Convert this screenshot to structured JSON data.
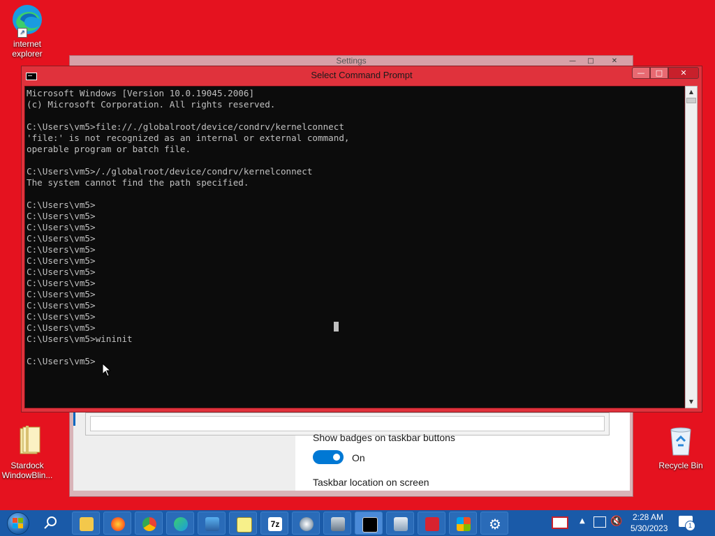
{
  "desktop": {
    "icons": [
      {
        "label": "internet\nexplorer",
        "label_line1": "internet",
        "label_line2": "explorer"
      },
      {
        "label_line1": "Stardock",
        "label_line2": "WindowBlin..."
      },
      {
        "label_line1": "Recycle Bin"
      }
    ]
  },
  "settings_window": {
    "title": "Settings",
    "badges_label": "Show badges on taskbar buttons",
    "toggle_state": "On",
    "location_label": "Taskbar location on screen",
    "accent": "#0078d4"
  },
  "cmd_window": {
    "title": "Select Command Prompt",
    "buttons": {
      "minimize": "—",
      "maximize": "□",
      "close": "✕"
    },
    "console_text": "Microsoft Windows [Version 10.0.19045.2006]\n(c) Microsoft Corporation. All rights reserved.\n\nC:\\Users\\vm5>file://./globalroot/device/condrv/kernelconnect\n'file:' is not recognized as an internal or external command,\noperable program or batch file.\n\nC:\\Users\\vm5>/./globalroot/device/condrv/kernelconnect\nThe system cannot find the path specified.\n\nC:\\Users\\vm5>\nC:\\Users\\vm5>\nC:\\Users\\vm5>\nC:\\Users\\vm5>\nC:\\Users\\vm5>\nC:\\Users\\vm5>\nC:\\Users\\vm5>\nC:\\Users\\vm5>\nC:\\Users\\vm5>\nC:\\Users\\vm5>\nC:\\Users\\vm5>\nC:\\Users\\vm5>\nC:\\Users\\vm5>wininit\n\nC:\\Users\\vm5>"
  },
  "taskbar": {
    "pinned": [
      "search-icon",
      "file-explorer-icon",
      "firefox-icon",
      "chrome-icon",
      "edge-icon",
      "photos-icon",
      "notepad-icon",
      "7zip-icon",
      "disk-utility-icon",
      "system-monitor-icon",
      "command-prompt-icon",
      "control-panel-icon",
      "toolbox-icon",
      "store-icon",
      "settings-icon"
    ],
    "time": "2:28 AM",
    "date": "5/30/2023",
    "notification_count": "1"
  },
  "colors": {
    "desktop_background": "#e5121f",
    "taskbar": "#1a5aa8",
    "console_background": "#0c0c0c",
    "console_text": "#c0c0c0"
  }
}
